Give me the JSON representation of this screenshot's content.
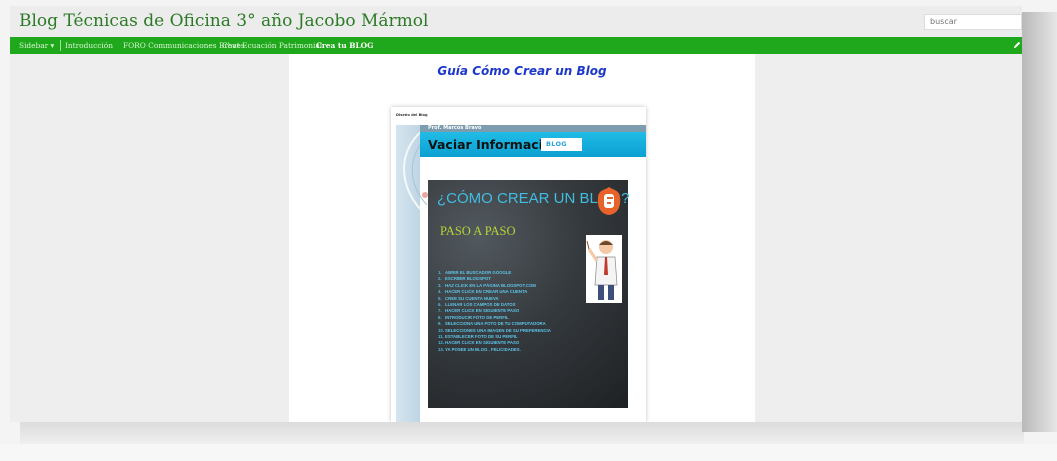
{
  "header": {
    "blog_title": "Blog Técnicas de Oficina 3° año Jacobo Mármol",
    "search_placeholder": "buscar"
  },
  "nav": {
    "items": [
      {
        "label": "Sidebar ▾",
        "active": false
      },
      {
        "label": "Introducción",
        "active": false
      },
      {
        "label": "FORO Communicaciones Breves",
        "active": false
      },
      {
        "label": "Chat Ecuación Patrimonial",
        "active": false
      },
      {
        "label": "Crea tu BLOG",
        "active": true
      }
    ],
    "edit_icon": "pencil-icon"
  },
  "post": {
    "title": "Guía Cómo Crear un Blog",
    "document": {
      "heading": "Diseño del Blog",
      "band_label": "Prof. Marcos Bravo",
      "band_title": "Vaciar Información al",
      "logo_text": "BLOG",
      "slide": {
        "title": "¿CÓMO CREAR UN BLOG?",
        "subtitle": "PASO A PASO",
        "steps": [
          {
            "num": "1.",
            "text": "ABRIR EL BUSCADOR GOOGLE"
          },
          {
            "num": "2.",
            "text": "ESCRIBIR BLOGSPOT"
          },
          {
            "num": "3.",
            "text": "HAZ CLICK EN LA PÁGINA BLOGSPOT.COM"
          },
          {
            "num": "4.",
            "text": "HACER CLICK EN CREAR UNA CUENTA"
          },
          {
            "num": "5.",
            "text": "CREE SU CUENTA NUEVA"
          },
          {
            "num": "6.",
            "text": "LLENAR LOS CAMPOS DE DATOS"
          },
          {
            "num": "7.",
            "text": "HACER CLICK EN SIGUIENTE PASO"
          },
          {
            "num": "8.",
            "text": "INTRODUCIR FOTO DE PERFIL"
          },
          {
            "num": "9.",
            "text": "SELECCIONA UNA FOTO DE TU COMPUTADORA"
          },
          {
            "num": "10.",
            "text": "SELECCIONES UNA IMAGEN DE SU PREFERENCIA"
          },
          {
            "num": "11.",
            "text": "ESTABLECER FOTO DE SU PERFIL"
          },
          {
            "num": "12.",
            "text": "HACER CLICK EN SIGUIENTE PASO"
          },
          {
            "num": "13.",
            "text": "YA POSEE UN BLOG . FELICIDADES."
          }
        ]
      }
    }
  },
  "colors": {
    "navbar": "#1fa81b",
    "title_green": "#2c7a26",
    "post_title_blue": "#1d37c8",
    "slide_accent": "#42bde0",
    "slide_sub": "#b6d534"
  }
}
